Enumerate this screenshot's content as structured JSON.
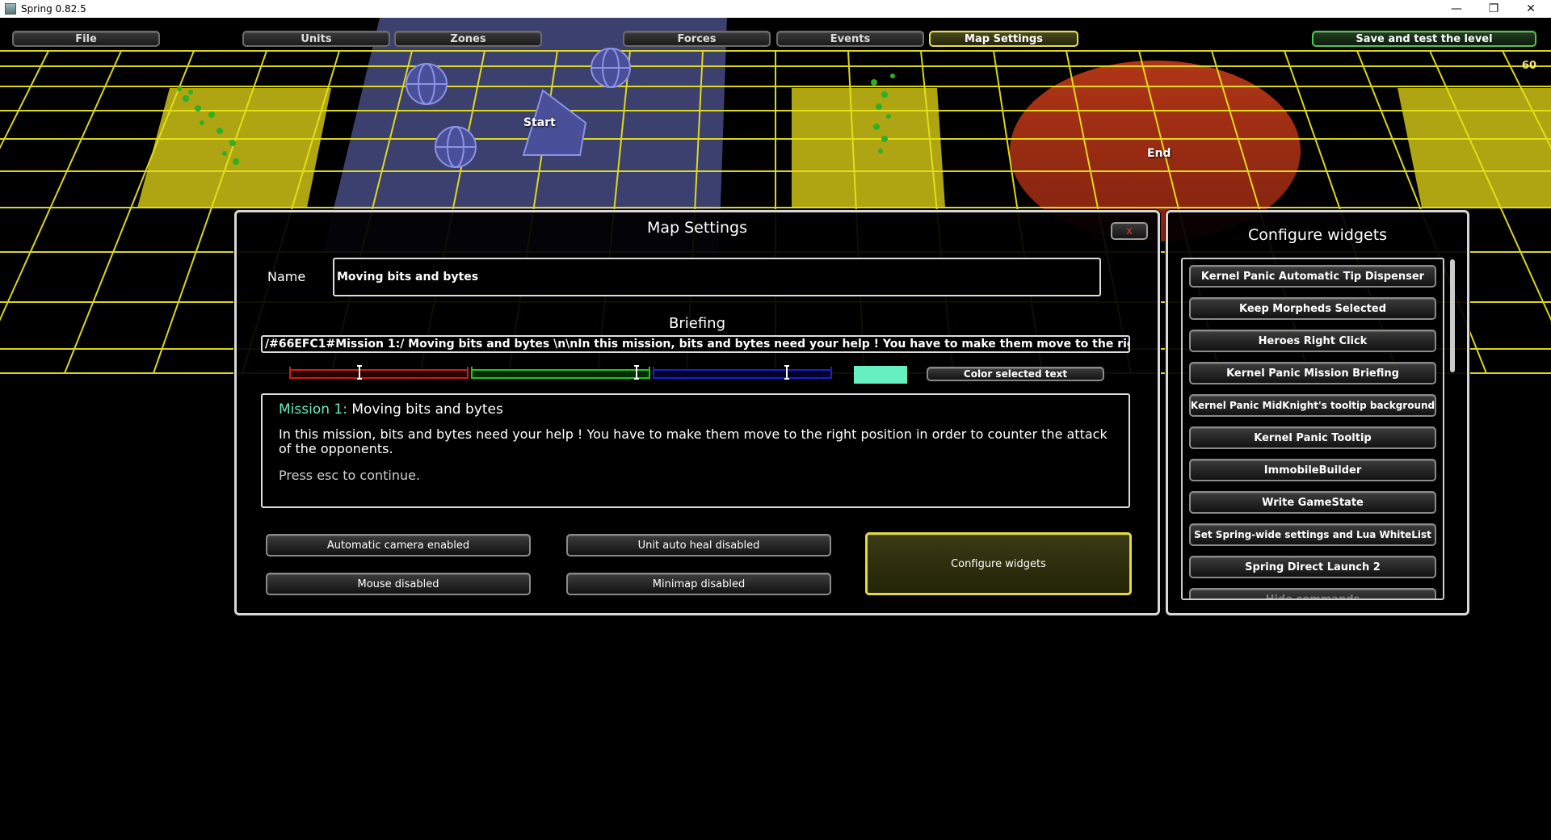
{
  "window": {
    "title": "Spring 0.82.5",
    "controls": {
      "minimize": "—",
      "restore": "❐",
      "close": "✕"
    }
  },
  "toolbar": {
    "file": "File",
    "units": "Units",
    "zones": "Zones",
    "forces": "Forces",
    "events": "Events",
    "map_settings": "Map Settings",
    "save_test": "Save and test the level"
  },
  "scene": {
    "start_label": "Start",
    "end_label": "End",
    "fps": "60",
    "colors": {
      "grid": "#e6e21a",
      "zone_yellow": "#b8ae14",
      "start_zone": "#6e74c8",
      "end_zone": "#b83214"
    }
  },
  "map_settings": {
    "title": "Map Settings",
    "close": "x",
    "name_label": "Name",
    "name_value": "Moving bits and bytes",
    "briefing_label": "Briefing",
    "briefing_raw": "/#66EFC1#Mission 1:/ Moving bits and bytes \\n\\nIn this mission, bits and bytes need your help ! You have to make them move to the right",
    "color_swatch": "#66efc1",
    "sliders": {
      "red": "#c81e1e",
      "green": "#1ec81e",
      "blue": "#1e1ec8"
    },
    "color_selected_text": "Color selected text",
    "preview": {
      "mission_prefix": "Mission 1:",
      "mission_title": " Moving bits and bytes",
      "body": "In this mission, bits and bytes need your help ! You have to make them move to the right position in order to counter the attack of the opponents.",
      "footer": "Press esc to continue."
    },
    "buttons": {
      "auto_camera": "Automatic camera enabled",
      "mouse": "Mouse disabled",
      "auto_heal": "Unit auto heal disabled",
      "minimap": "Minimap disabled",
      "configure_widgets": "Configure widgets"
    }
  },
  "widgets_panel": {
    "title": "Configure widgets",
    "items": [
      "Kernel Panic Automatic Tip Dispenser",
      "Keep Morpheds Selected",
      "Heroes Right Click",
      "Kernel Panic Mission Briefing",
      "Kernel Panic MidKnight's tooltip background",
      "Kernel Panic Tooltip",
      "ImmobileBuilder",
      "Write GameState",
      "Set Spring-wide settings and Lua WhiteList",
      "Spring Direct Launch 2",
      "Hide commands"
    ]
  }
}
